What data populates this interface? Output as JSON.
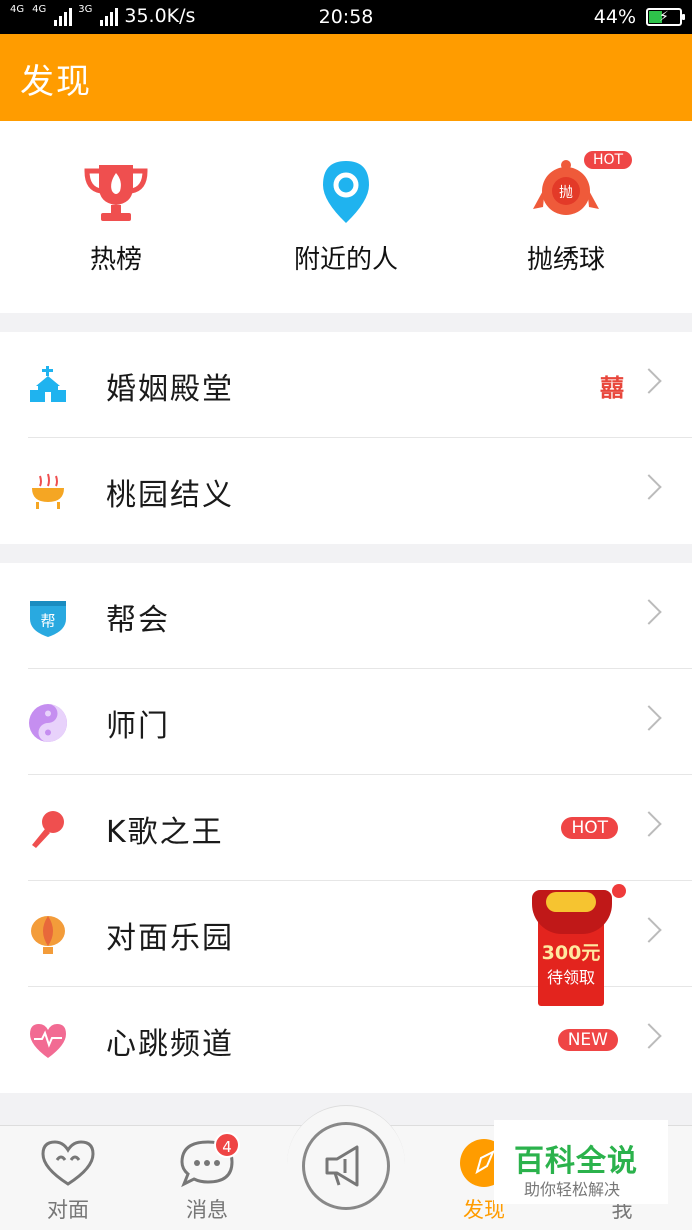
{
  "status_bar": {
    "net1": "4G",
    "net2": "4G",
    "net3": "3G",
    "speed": "35.0K/s",
    "time": "20:58",
    "battery": "44%",
    "battery_level": 0.44
  },
  "header": {
    "title": "发现"
  },
  "features": [
    {
      "label": "热榜",
      "icon": "trophy-icon"
    },
    {
      "label": "附近的人",
      "icon": "location-pin-icon"
    },
    {
      "label": "抛绣球",
      "icon": "embroidered-ball-icon",
      "badge": "HOT"
    }
  ],
  "section1": [
    {
      "label": "婚姻殿堂",
      "icon": "chapel-icon",
      "extra": "囍"
    },
    {
      "label": "桃园结义",
      "icon": "incense-burner-icon"
    }
  ],
  "section2": [
    {
      "label": "帮会",
      "icon": "gang-shield-icon",
      "icon_text": "帮"
    },
    {
      "label": "师门",
      "icon": "yin-yang-icon"
    },
    {
      "label": "K歌之王",
      "icon": "microphone-icon",
      "tag": "HOT"
    },
    {
      "label": "对面乐园",
      "icon": "hot-air-balloon-icon"
    },
    {
      "label": "心跳频道",
      "icon": "heartbeat-icon",
      "tag": "NEW"
    }
  ],
  "promo": {
    "amount": "300元",
    "text": "待领取"
  },
  "tabbar": {
    "tabs": [
      {
        "label": "对面",
        "icon": "heart-face-icon"
      },
      {
        "label": "消息",
        "icon": "chat-bubble-icon",
        "badge": "4"
      },
      {
        "label": "发现",
        "icon": "compass-icon",
        "active": true
      },
      {
        "label": "我",
        "icon": "profile-icon"
      }
    ]
  },
  "watermark": {
    "title": "百科全说",
    "subtitle": "助你轻松解决"
  },
  "colors": {
    "accent": "#ff9c00",
    "red": "#ef4545",
    "bg": "#f2f2f4"
  }
}
